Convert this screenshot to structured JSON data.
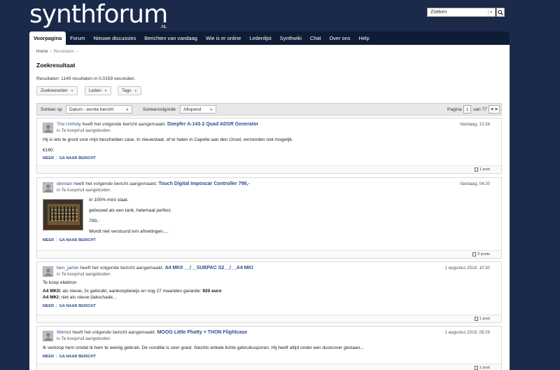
{
  "site": {
    "logo_text": "synthforum",
    "logo_tld": ".NL"
  },
  "search": {
    "placeholder": "Zoeken"
  },
  "nav": [
    {
      "label": "Voorpagina",
      "active": true
    },
    {
      "label": "Forum"
    },
    {
      "label": "Nieuwe discussies"
    },
    {
      "label": "Berichten van vandaag"
    },
    {
      "label": "Wie is er online"
    },
    {
      "label": "Ledenlijst"
    },
    {
      "label": "Synthwiki"
    },
    {
      "label": "Chat"
    },
    {
      "label": "Over ons"
    },
    {
      "label": "Help"
    }
  ],
  "breadcrumb": {
    "home": "Home",
    "current": "Resultaten"
  },
  "page_title": "Zoekresultaat",
  "results_summary": "Resultaten: 1149 resultaten in 0,0159 seconden.",
  "filters": {
    "keywords": "Zoekwoorden",
    "members": "Leden",
    "tags": "Tags"
  },
  "sortbar": {
    "sort_label": "Sorteer op",
    "sort_value": "Datum - eerste bericht",
    "order_label": "Sorteervolgorde",
    "order_value": "Aflopend",
    "page_label": "Pagina",
    "page_current": "1",
    "page_total": "van 77"
  },
  "result_common": {
    "action_text": "heeft het volgende bericht aangemaakt:",
    "more": "MEER",
    "goto": "GA NAAR BERICHT"
  },
  "results": [
    {
      "user": "The Unholy",
      "title": "Doepfer A-143-2 Quad ADSR Generator",
      "forum": "in Te koop/ruil aangeboden",
      "date": "Vandaag, 13:34",
      "lines": [
        "Hij is iets te groot voor mijn bescheiden case. In nieuwstaat, af te halen in Capelle aan den IJssel, verzenden ook mogelijk.",
        "€160."
      ],
      "posts": "1 post"
    },
    {
      "user": "demian",
      "title": "Touch Digital Imposcar Controller 799,-",
      "forum": "in Te koop/ruil aangeboden",
      "date": "Vandaag, 04:20",
      "lines": [
        "In 100% mint staat.",
        "gebouwd als een tank, helemaal perfect.",
        "799,-",
        "Wordt niet verstuurd ivm afmetingen...."
      ],
      "posts": "3 posts"
    },
    {
      "user": "ben_jamin",
      "title": "A4 MKII __/__SUBPAC S2__/__A4 MKI",
      "forum": "in Te koop/ruil aangeboden",
      "date": "1 augustus 2018, 10:30",
      "lines": [
        "Te koop elektron"
      ],
      "line_a4mk2_label": "A4 MKII:",
      "line_a4mk2_text": " als nieuw, 2x gebruikt, aankoopbewijs en nog 27 maanden garantie: ",
      "line_a4mk2_price": "920 euro",
      "line_a4mk1_label": "A4 MKI:",
      "line_a4mk1_text": " niet als nieuw (lakschade...",
      "posts": "1 post"
    },
    {
      "user": "Wimist",
      "title": "MOOG Little Phatty + THON Flightcase",
      "forum": "in Te koop/ruil aangeboden",
      "date": "1 augustus 2018, 09:29",
      "lines": [
        "Ik verkoop hem omdat ik hem te weinig gebruik. De conditie is zeer goed. Slechts enkele lichte gebruikssporen. Hij heeft altijd onder een dustcover gestaan..."
      ],
      "posts": "1 post"
    }
  ]
}
